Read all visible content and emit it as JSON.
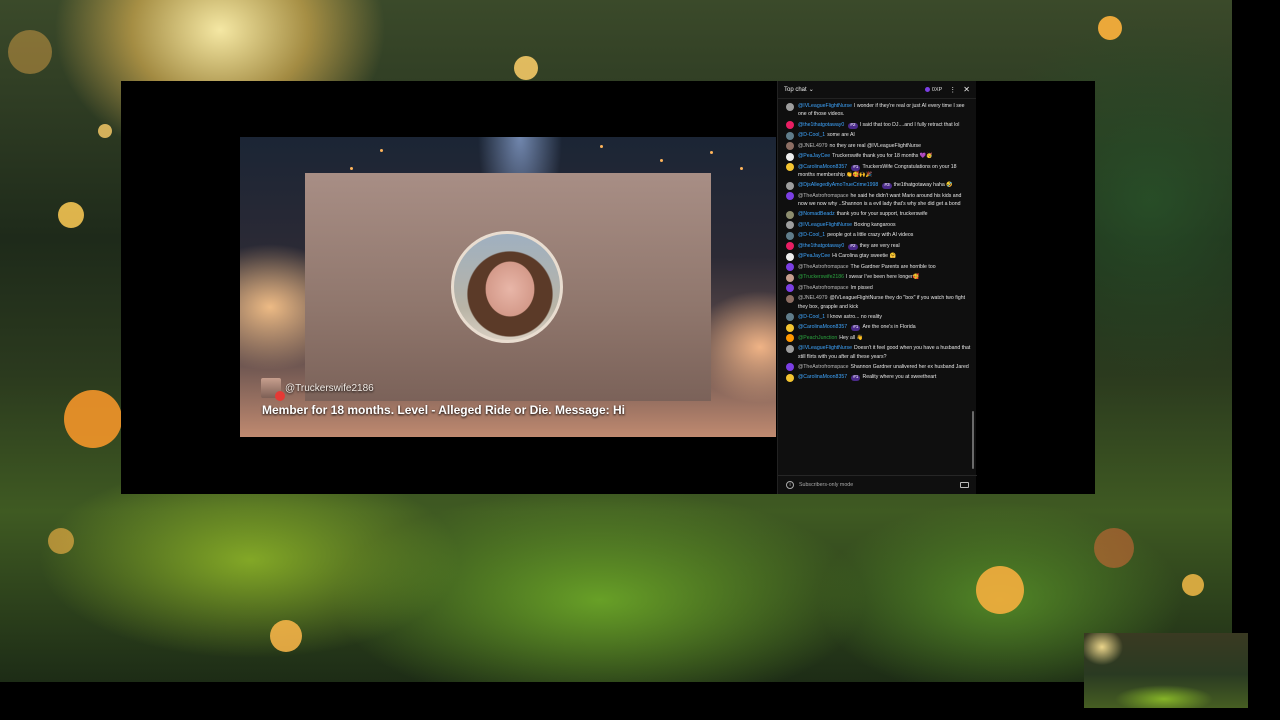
{
  "stream": {
    "alert_username": "@Truckerswife2186",
    "alert_message": "Member for 18 months. Level - Alleged Ride or Die. Message: Hi"
  },
  "chat": {
    "header_title": "Top chat",
    "xp_label": "0XP",
    "footer_mode": "Subscribers-only mode",
    "messages": [
      {
        "user": "@IVLeagueFlightNurse",
        "rank": "",
        "text": "I wonder if they're real or just AI every time I see one of those videos.",
        "color": "#9e9e9e",
        "ucls": "u"
      },
      {
        "user": "@the1thatgotaway0",
        "rank": "#2",
        "text": "I said that too DJ....and I fully retract that lol",
        "color": "#e91e63",
        "ucls": "u"
      },
      {
        "user": "@D-Cool_1",
        "rank": "",
        "text": "some are AI",
        "color": "#607d8b",
        "ucls": "u"
      },
      {
        "user": "@JNEL4979",
        "rank": "",
        "text": "no they are real @IVLeagueFlightNurse",
        "color": "#8d6e63",
        "ucls": "u gray"
      },
      {
        "user": "@PeaJayCee",
        "rank": "",
        "text": "Truckerswife thank you for 18 months 💜🥳",
        "color": "#eeeeee",
        "ucls": "u"
      },
      {
        "user": "@CarolinaMoon8357",
        "rank": "#1",
        "text": "TruckersWife Congratulations on your 18 months membership 👏🥰🙌🎉",
        "color": "#f4c430",
        "ucls": "u"
      },
      {
        "user": "@DjsAllegedlyAmoTrueCrime1998",
        "rank": "#3",
        "text": "the1thatgotaway haha 🤣",
        "color": "#9e9e9e",
        "ucls": "u"
      },
      {
        "user": "@TheAstrofromspace",
        "rank": "",
        "text": "he said he didn't want Mario around his kids and now we now why ..Shannon is a evil lady that's why she did get a bond",
        "color": "#7b3fe4",
        "ucls": "u gray"
      },
      {
        "user": "@NomadBeadz",
        "rank": "",
        "text": "thank you for your support, truckerswife",
        "color": "#8d8d6e",
        "ucls": "u"
      },
      {
        "user": "@IVLeagueFlightNurse",
        "rank": "",
        "text": "Boxing kangaroos",
        "color": "#9e9e9e",
        "ucls": "u"
      },
      {
        "user": "@D-Cool_1",
        "rank": "",
        "text": "people got a little crazy with AI videos",
        "color": "#607d8b",
        "ucls": "u"
      },
      {
        "user": "@the1thatgotaway0",
        "rank": "#2",
        "text": "they are very real",
        "color": "#e91e63",
        "ucls": "u"
      },
      {
        "user": "@PeaJayCee",
        "rank": "",
        "text": "Hi Carolina gtay sweetie 🤗",
        "color": "#eeeeee",
        "ucls": "u"
      },
      {
        "user": "@TheAstrofromspace",
        "rank": "",
        "text": "The Gardner Parents are horrible too",
        "color": "#7b3fe4",
        "ucls": "u gray"
      },
      {
        "user": "@Truckerswife2186",
        "rank": "",
        "text": "I swear I've been here longer🥰",
        "color": "#c79f8e",
        "ucls": "u green"
      },
      {
        "user": "@TheAstrofromspace",
        "rank": "",
        "text": "Im pissed",
        "color": "#7b3fe4",
        "ucls": "u gray"
      },
      {
        "user": "@JNEL4979",
        "rank": "",
        "text": "@IVLeagueFlightNurse they do \"box\" if you watch two fight they box, grapple and kick",
        "color": "#8d6e63",
        "ucls": "u gray"
      },
      {
        "user": "@D-Cool_1",
        "rank": "",
        "text": "I know astro... no reality",
        "color": "#607d8b",
        "ucls": "u"
      },
      {
        "user": "@CarolinaMoon8357",
        "rank": "#1",
        "text": "Are the one's in Florida",
        "color": "#f4c430",
        "ucls": "u"
      },
      {
        "user": "@PeachJunction",
        "rank": "",
        "text": "Hey all 👋",
        "color": "#ff9800",
        "ucls": "u green"
      },
      {
        "user": "@IVLeagueFlightNurse",
        "rank": "",
        "text": "Doesn't it feel good when you have a husband that still flirts with you after all these years?",
        "color": "#9e9e9e",
        "ucls": "u"
      },
      {
        "user": "@TheAstrofromspace",
        "rank": "",
        "text": "Shannon Gardner unalivered her ex husband Jared",
        "color": "#7b3fe4",
        "ucls": "u gray"
      },
      {
        "user": "@CarolinaMoon8357",
        "rank": "#1",
        "text": "Reality where you at sweetheart",
        "color": "#f4c430",
        "ucls": "u"
      }
    ]
  },
  "icons": {
    "chevron": "chevron-down-icon",
    "more": "more-vert-icon",
    "close": "close-icon",
    "info": "info-icon"
  }
}
